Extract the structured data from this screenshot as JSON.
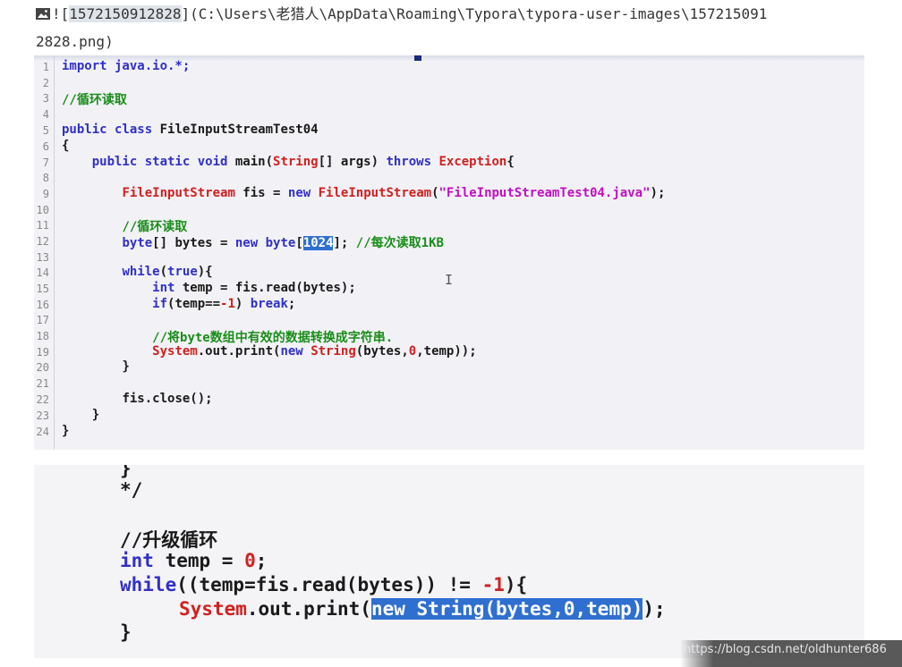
{
  "markdown_line": {
    "prefix": "![",
    "alt_text": "1572150912828",
    "middle": "](C:\\Users\\老猎人\\AppData\\Roaming\\Typora\\typora-user-images\\157215091",
    "line2": "2828.png)",
    "icon": "image-icon"
  },
  "editor": {
    "line_numbers": [
      "1",
      "2",
      "3",
      "4",
      "5",
      "6",
      "7",
      "8",
      "9",
      "10",
      "11",
      "12",
      "13",
      "14",
      "15",
      "16",
      "17",
      "18",
      "19",
      "20",
      "21",
      "22",
      "23",
      "24"
    ],
    "l1": "import java.io.*;",
    "l3": "//循环读取",
    "l5_kw": "public class",
    "l5_name": " FileInputStreamTest04",
    "l6": "{",
    "l7_kw": "public static void",
    "l7_main": " main(",
    "l7_string": "String",
    "l7_args": "[] args) ",
    "l7_throws": "throws",
    "l7_sp": " ",
    "l7_exc": "Exception",
    "l7_brace": "{",
    "l9_type": "FileInputStream",
    "l9_fis": " fis = ",
    "l9_new": "new",
    "l9_sp": " ",
    "l9_type2": "FileInputStream",
    "l9_open": "(",
    "l9_str": "\"FileInputStreamTest04.java\"",
    "l9_close": ");",
    "l11": "//循环读取",
    "l12_byte": "byte",
    "l12_mid": "[] bytes = ",
    "l12_new": "new",
    "l12_sp": " ",
    "l12_byte2": "byte",
    "l12_open": "[",
    "l12_sel": "1024",
    "l12_close": "]; ",
    "l12_comment": "//每次读取1KB",
    "l14_while": "while",
    "l14_open": "(",
    "l14_true": "true",
    "l14_close": "){",
    "l15_int": "int",
    "l15_rest": " temp = fis.read(bytes);",
    "l16_if": "if",
    "l16_cond": "(temp==",
    "l16_num": "-1",
    "l16_paren": ") ",
    "l16_break": "break",
    "l16_semi": ";",
    "l18": "//将byte数组中有效的数据转换成字符串.",
    "l19_system": "System",
    "l19_mid": ".out.print(",
    "l19_new": "new",
    "l19_sp": " ",
    "l19_string": "String",
    "l19_args1": "(bytes,",
    "l19_zero": "0",
    "l19_args2": ",temp));",
    "l20": "}",
    "l22": "fis.close();",
    "l23": "}",
    "l24": "}",
    "cursor": "I"
  },
  "snippet": {
    "s1": "}",
    "s2": "*/",
    "s4": "//升级循环",
    "s5_int": "int",
    "s5_rest": " temp = ",
    "s5_zero": "0",
    "s5_semi": ";",
    "s6_while": "while",
    "s6_mid": "((temp=fis.read(bytes)) != ",
    "s6_num": "-1",
    "s6_end": "){",
    "s7_system": "System",
    "s7_mid": ".out.print(",
    "s7_sel": "new String(bytes,0,temp)",
    "s7_end": ");",
    "s8": "}"
  },
  "watermark": "https://blog.csdn.net/oldhunter686"
}
